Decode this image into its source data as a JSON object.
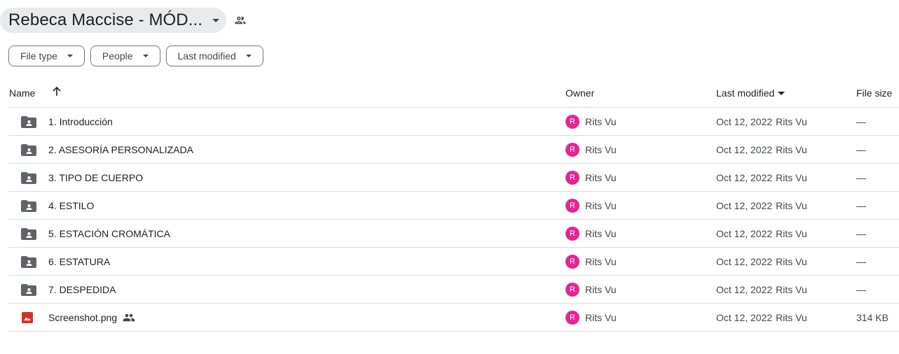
{
  "title": {
    "text": "Rebeca Maccise - MÓD...",
    "caret_icon": "caret-down-icon",
    "share_icon": "shared-people-icon"
  },
  "filters": [
    {
      "label": "File type"
    },
    {
      "label": "People"
    },
    {
      "label": "Last modified"
    }
  ],
  "columns": {
    "name": "Name",
    "owner": "Owner",
    "last_modified": "Last modified",
    "file_size": "File size"
  },
  "sort": {
    "name_sort_icon": "arrow-up-icon",
    "active_column": "Last modified",
    "direction": "descending"
  },
  "rows": [
    {
      "type": "shared-folder",
      "name": "1. Introducción",
      "owner_initial": "R",
      "owner": "Rits Vu",
      "modified_date": "Oct 12, 2022",
      "modified_by": "Rits Vu",
      "size": "—"
    },
    {
      "type": "shared-folder",
      "name": "2. ASESORÍA PERSONALIZADA",
      "owner_initial": "R",
      "owner": "Rits Vu",
      "modified_date": "Oct 12, 2022",
      "modified_by": "Rits Vu",
      "size": "—"
    },
    {
      "type": "shared-folder",
      "name": "3. TIPO DE CUERPO",
      "owner_initial": "R",
      "owner": "Rits Vu",
      "modified_date": "Oct 12, 2022",
      "modified_by": "Rits Vu",
      "size": "—"
    },
    {
      "type": "shared-folder",
      "name": "4. ESTILO",
      "owner_initial": "R",
      "owner": "Rits Vu",
      "modified_date": "Oct 12, 2022",
      "modified_by": "Rits Vu",
      "size": "—"
    },
    {
      "type": "shared-folder",
      "name": "5. ESTACIÓN CROMÁTICA",
      "owner_initial": "R",
      "owner": "Rits Vu",
      "modified_date": "Oct 12, 2022",
      "modified_by": "Rits Vu",
      "size": "—"
    },
    {
      "type": "shared-folder",
      "name": "6. ESTATURA",
      "owner_initial": "R",
      "owner": "Rits Vu",
      "modified_date": "Oct 12, 2022",
      "modified_by": "Rits Vu",
      "size": "—"
    },
    {
      "type": "shared-folder",
      "name": "7. DESPEDIDA",
      "owner_initial": "R",
      "owner": "Rits Vu",
      "modified_date": "Oct 12, 2022",
      "modified_by": "Rits Vu",
      "size": "—"
    },
    {
      "type": "image",
      "name": "Screenshot.png",
      "shared": true,
      "owner_initial": "R",
      "owner": "Rits Vu",
      "modified_date": "Oct 12, 2022",
      "modified_by": "Rits Vu",
      "size": "314 KB"
    }
  ],
  "colors": {
    "avatar": "#e52592",
    "image_icon": "#d93025",
    "folder_icon": "#5f6368"
  }
}
